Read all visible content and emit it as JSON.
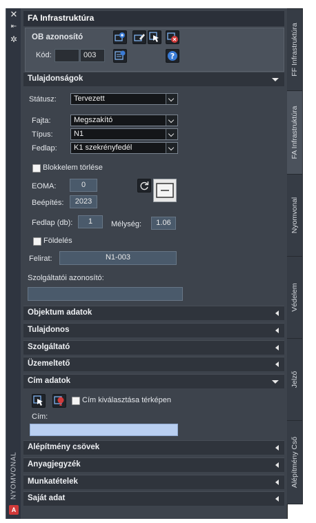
{
  "palette": {
    "title": "FA Infrastruktúra",
    "side_label": "NYOMVONAL",
    "app_badge": "A"
  },
  "ob": {
    "heading": "OB azonosító",
    "kod_label": "Kód:",
    "kod_prefix": "",
    "kod_value": "003"
  },
  "sections": {
    "tulajdonsagok": "Tulajdonságok",
    "objektum": "Objektum adatok",
    "tulajdonos": "Tulajdonos",
    "szolgaltato": "Szolgáltató",
    "uzemelteto": "Üzemeltető",
    "cim": "Cím adatok",
    "alepitmeny": "Alépítmény csövek",
    "anyagjegyzek": "Anyagjegyzék",
    "munkatetelek": "Munkatételek",
    "sajat": "Saját adat"
  },
  "props": {
    "status_label": "Státusz:",
    "status_value": "Tervezett",
    "fajta_label": "Fajta:",
    "fajta_value": "Megszakító",
    "tipus_label": "Típus:",
    "tipus_value": "N1",
    "fedlap_label": "Fedlap:",
    "fedlap_value": "K1 szekrényfedél",
    "blokk_label": "Blokkelem törlése",
    "eoma_label": "EOMA:",
    "eoma_value": "0",
    "beepites_label": "Beépítés:",
    "beepites_value": "2023",
    "fedlapdb_label": "Fedlap (db):",
    "fedlapdb_value": "1",
    "melyseg_label": "Mélység:",
    "melyseg_value": "1.06",
    "foldeles_label": "Földelés",
    "felirat_label": "Felirat:",
    "felirat_value": "N1-003",
    "szolg_azon_label": "Szolgáltatói azonosító:",
    "szolg_azon_value": ""
  },
  "cim": {
    "checkbox_label": "Cím kiválasztása térképen",
    "cim_label": "Cím:",
    "cim_value": ""
  },
  "tabs": [
    "FF Infrastruktúra",
    "FA Infrastruktúra",
    "Nyomvonal",
    "Védelem",
    "Jelző",
    "Alépítmény Cső"
  ],
  "colors": {
    "panel": "#3d434c",
    "section_header": "#2f343c",
    "address_field": "#b9cff1",
    "icon_blue": "#3a7bd5",
    "icon_red": "#d13a3a"
  },
  "icons": [
    "close-icon",
    "pin-icon",
    "settings-icon",
    "add-object-icon",
    "edit-object-icon",
    "select-pointer-icon",
    "delete-object-icon",
    "id-list-icon",
    "help-icon",
    "refresh-icon",
    "block-preview-icon",
    "map-pick-icon",
    "map-marker-icon"
  ]
}
